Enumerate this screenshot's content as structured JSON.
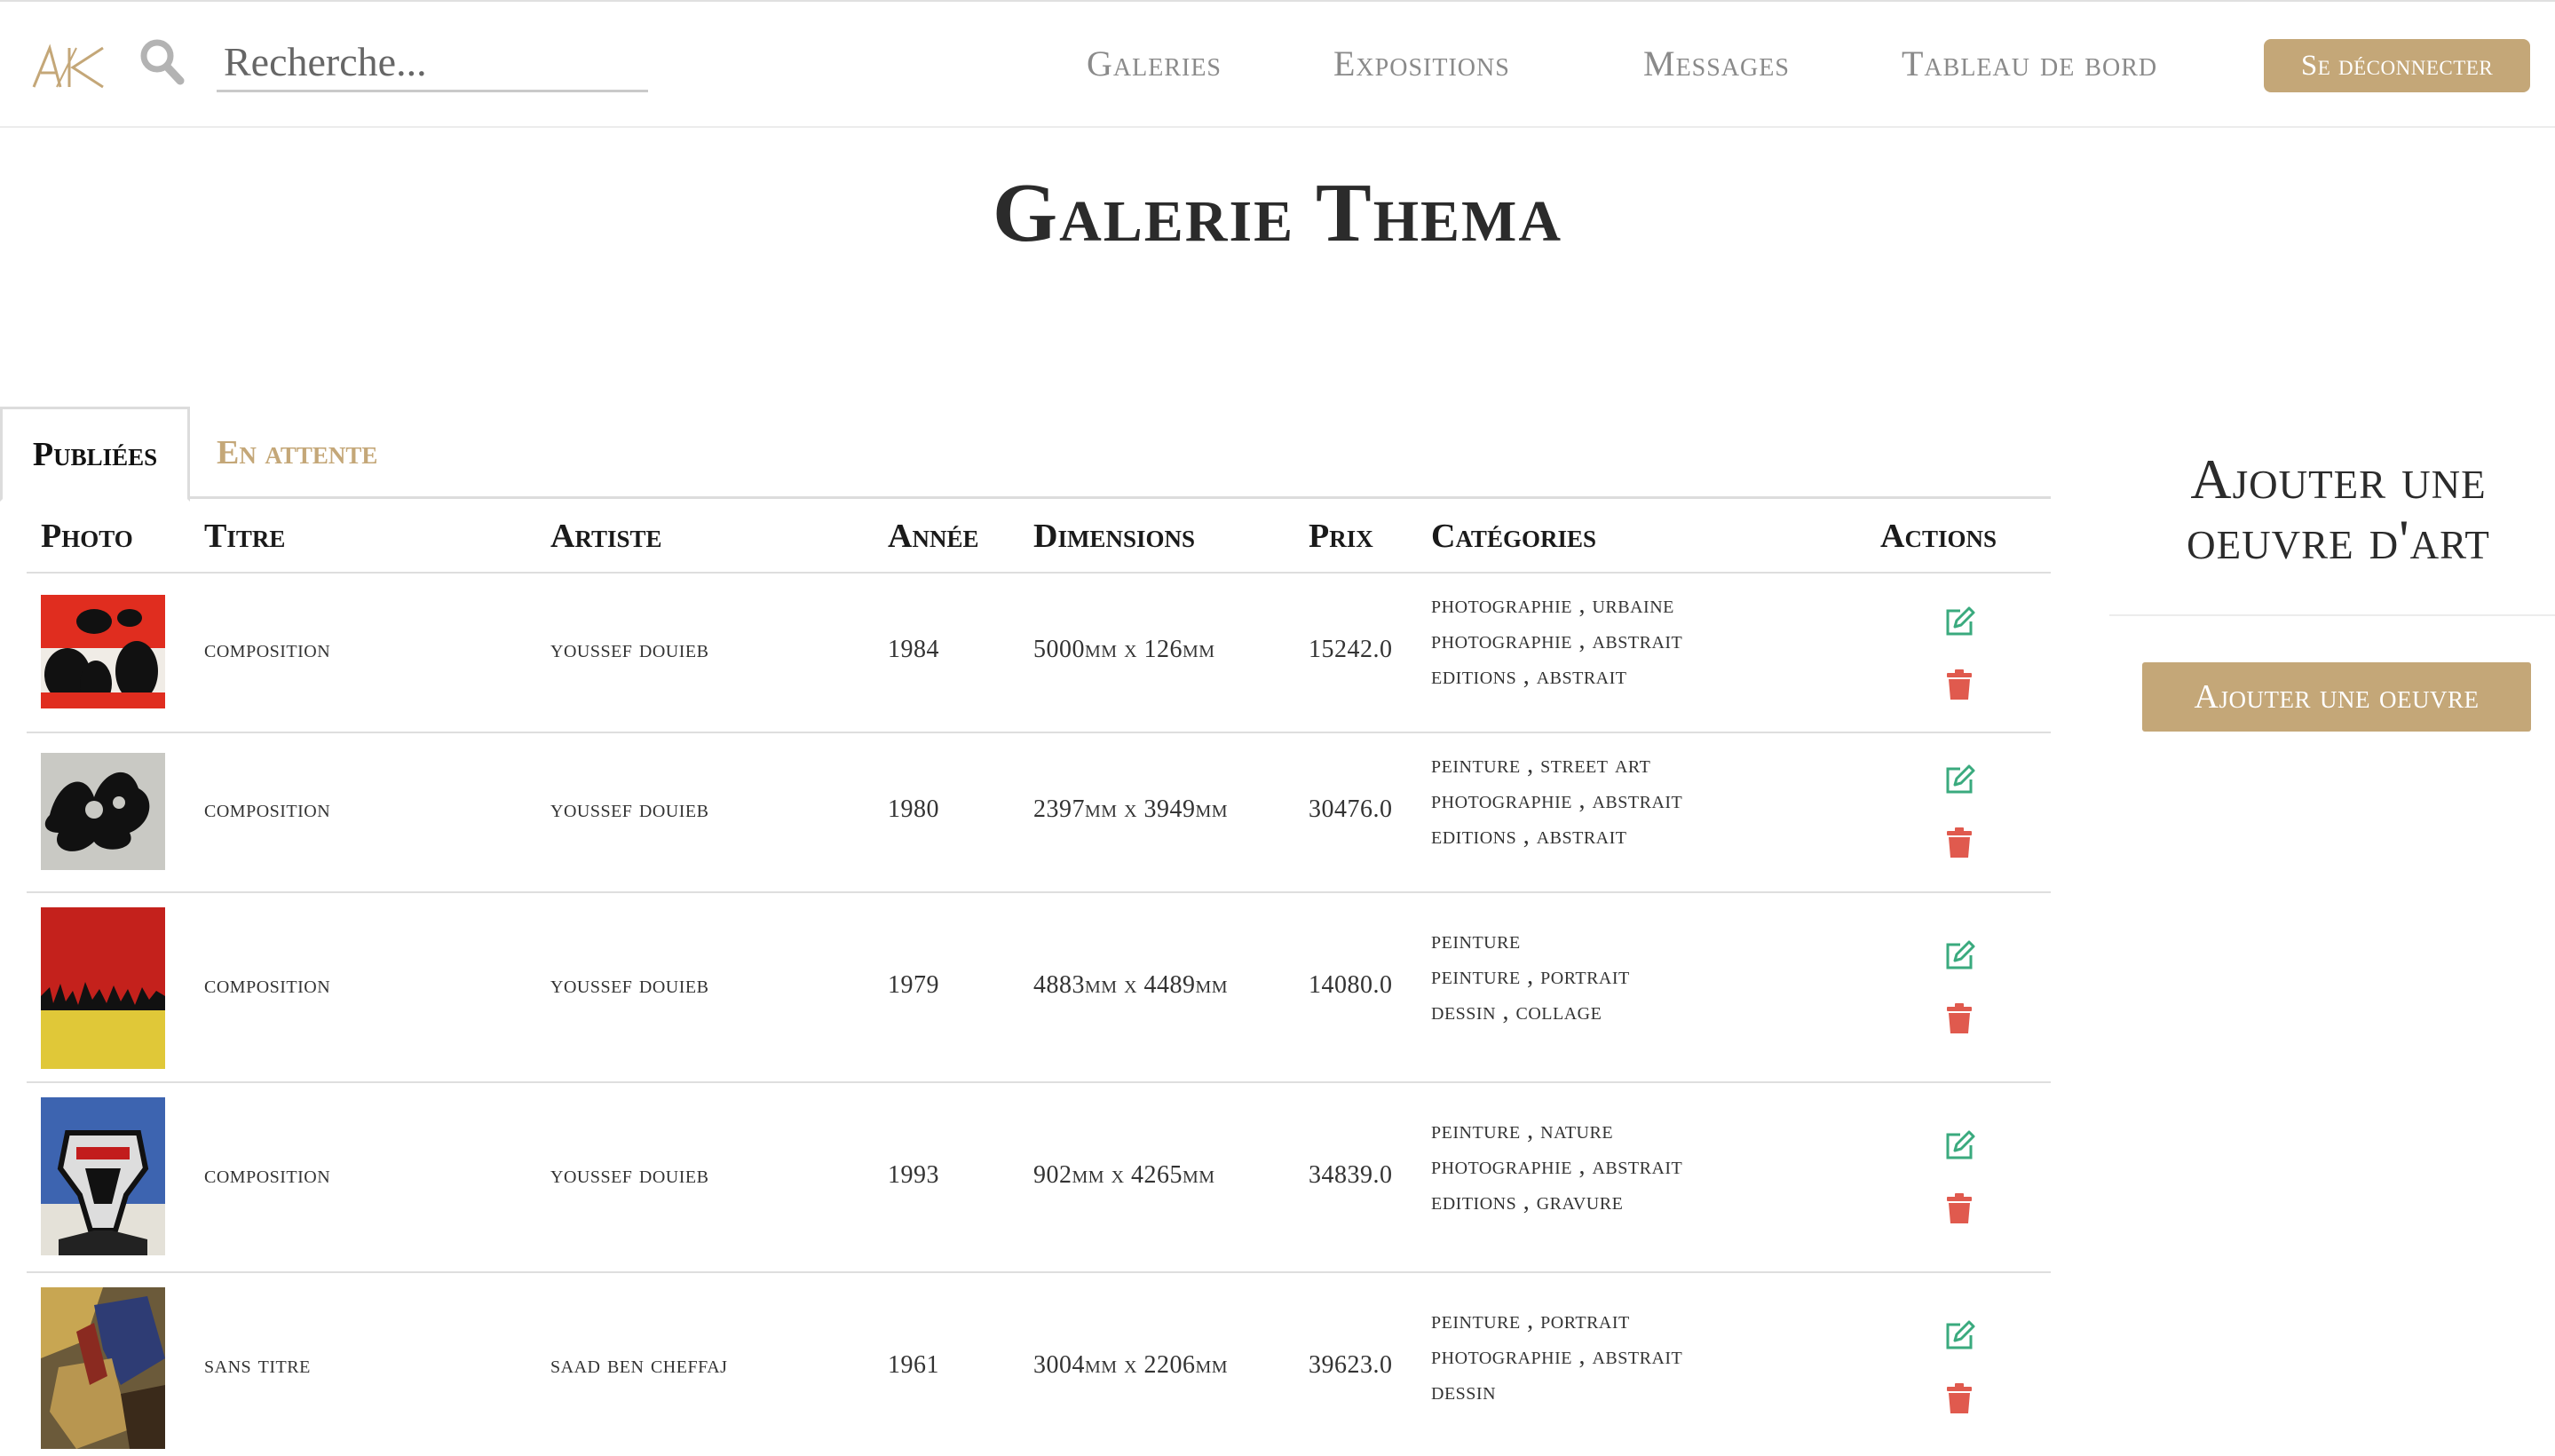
{
  "nav": {
    "logo_text": "AK",
    "search_placeholder": "Recherche...",
    "links": [
      "Galeries",
      "Expositions",
      "Messages",
      "Tableau de bord"
    ],
    "logout_label": "Se déconnecter"
  },
  "page": {
    "title_prefix": "Galerie",
    "title_name": "Thema"
  },
  "tabs": [
    "Publiées",
    "En attente"
  ],
  "table": {
    "headers": [
      "Photo",
      "Titre",
      "Artiste",
      "Année",
      "Dimensions",
      "Prix",
      "Catégories",
      "Actions"
    ],
    "rows": [
      {
        "title": "composition",
        "artist": "youssef douieb",
        "year": "1984",
        "dimensions": "5000mm x 126mm",
        "price": "15242.0",
        "categories": [
          "photographie , urbaine",
          "photographie , abstrait",
          "editions , abstrait"
        ]
      },
      {
        "title": "composition",
        "artist": "youssef douieb",
        "year": "1980",
        "dimensions": "2397mm x 3949mm",
        "price": "30476.0",
        "categories": [
          "peinture , street art",
          "photographie , abstrait",
          "editions , abstrait"
        ]
      },
      {
        "title": "composition",
        "artist": "youssef douieb",
        "year": "1979",
        "dimensions": "4883mm x 4489mm",
        "price": "14080.0",
        "categories": [
          "peinture",
          "peinture , portrait",
          "dessin , collage"
        ]
      },
      {
        "title": "composition",
        "artist": "youssef douieb",
        "year": "1993",
        "dimensions": "902mm x 4265mm",
        "price": "34839.0",
        "categories": [
          "peinture , nature",
          "photographie , abstrait",
          "editions , gravure"
        ]
      },
      {
        "title": "sans titre",
        "artist": "saad ben cheffaj",
        "year": "1961",
        "dimensions": "3004mm x 2206mm",
        "price": "39623.0",
        "categories": [
          "peinture , portrait",
          "photographie , abstrait",
          "dessin"
        ]
      }
    ]
  },
  "sidebar": {
    "title_line1": "Ajouter une",
    "title_line2": "oeuvre d'art",
    "add_button_label": "Ajouter une oeuvre"
  },
  "colors": {
    "accent": "#c4a778",
    "edit": "#3aaa7e",
    "delete": "#e05a4e"
  }
}
